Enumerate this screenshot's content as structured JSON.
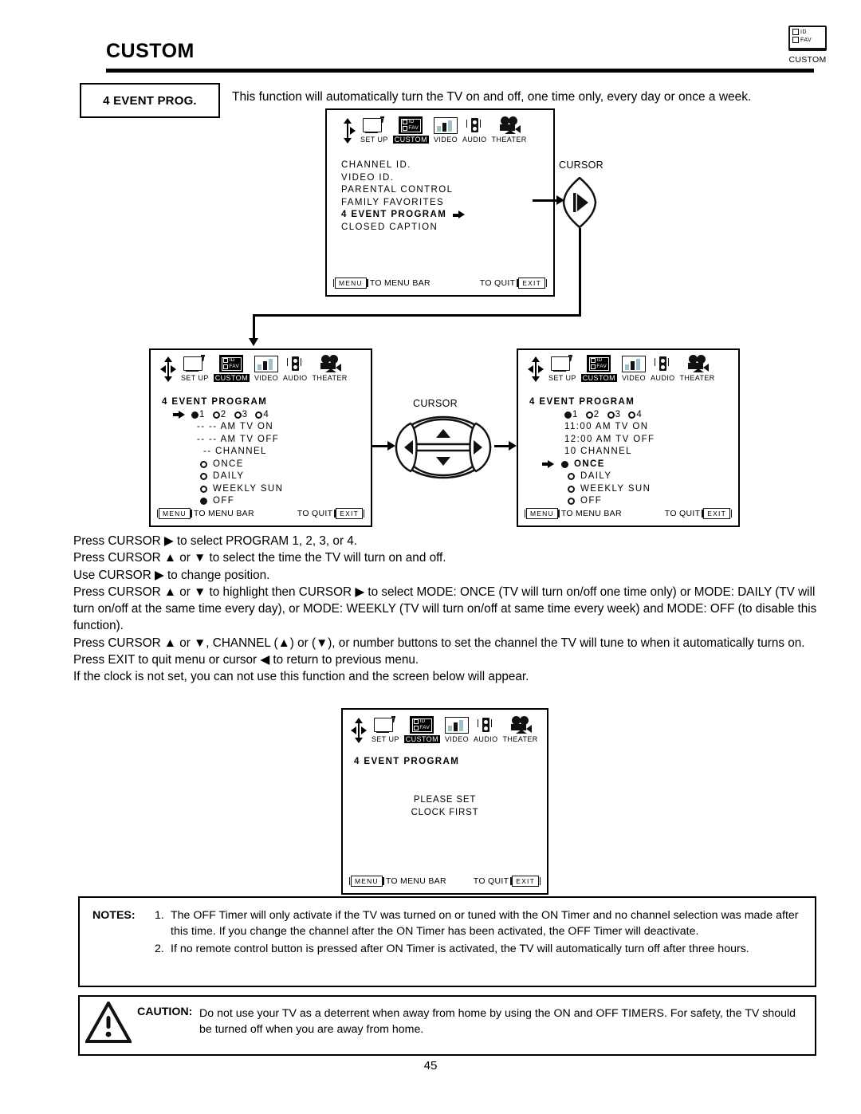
{
  "header": {
    "title": "CUSTOM",
    "corner_logo": {
      "icon": "custom-tv-icon",
      "line1": "ID",
      "line2": "FAV",
      "caption": "CUSTOM"
    }
  },
  "topic": {
    "box_label": "4 EVENT PROG.",
    "intro": "This function will automatically turn the TV on and off, one time only, every day or once a week."
  },
  "menu_icons": [
    {
      "name": "setup-icon",
      "label": "SET UP",
      "selected": false
    },
    {
      "name": "custom-icon",
      "label": "CUSTOM",
      "selected": true
    },
    {
      "name": "video-icon",
      "label": "VIDEO",
      "selected": false
    },
    {
      "name": "audio-icon",
      "label": "AUDIO",
      "selected": false
    },
    {
      "name": "theater-icon",
      "label": "THEATER",
      "selected": false
    }
  ],
  "osd_footer": {
    "menu_key": "MENU",
    "menu_text": "TO MENU BAR",
    "quit_text": "TO QUIT",
    "exit_key": "EXIT"
  },
  "screen_custom_menu": {
    "items": [
      {
        "label": "CHANNEL ID.",
        "highlighted": false,
        "arrow": false
      },
      {
        "label": "VIDEO ID.",
        "highlighted": false,
        "arrow": false
      },
      {
        "label": "PARENTAL CONTROL",
        "highlighted": false,
        "arrow": false
      },
      {
        "label": "FAMILY FAVORITES",
        "highlighted": false,
        "arrow": false
      },
      {
        "label": "4 EVENT PROGRAM",
        "highlighted": true,
        "arrow": true
      },
      {
        "label": "CLOSED CAPTION",
        "highlighted": false,
        "arrow": false
      }
    ]
  },
  "screen_event_blank": {
    "title": "4 EVENT PROGRAM",
    "programs": [
      {
        "label": "1",
        "selected": true
      },
      {
        "label": "2",
        "selected": false
      },
      {
        "label": "3",
        "selected": false
      },
      {
        "label": "4",
        "selected": false
      }
    ],
    "program_row_cursor": true,
    "on_time": "-- --  AM TV ON",
    "off_time": "-- --  AM TV OFF",
    "channel": "--  CHANNEL",
    "modes": [
      {
        "label": "ONCE",
        "selected": false,
        "cursor": false
      },
      {
        "label": "DAILY",
        "selected": false,
        "cursor": false
      },
      {
        "label": "WEEKLY  SUN",
        "selected": false,
        "cursor": false
      },
      {
        "label": "OFF",
        "selected": true,
        "cursor": false
      }
    ]
  },
  "screen_event_filled": {
    "title": "4 EVENT PROGRAM",
    "programs": [
      {
        "label": "1",
        "selected": true
      },
      {
        "label": "2",
        "selected": false
      },
      {
        "label": "3",
        "selected": false
      },
      {
        "label": "4",
        "selected": false
      }
    ],
    "program_row_cursor": false,
    "on_time": "11:00 AM TV ON",
    "off_time": "12:00 AM TV OFF",
    "channel": "10 CHANNEL",
    "modes": [
      {
        "label": "ONCE",
        "selected": true,
        "cursor": true
      },
      {
        "label": "DAILY",
        "selected": false,
        "cursor": false
      },
      {
        "label": "WEEKLY  SUN",
        "selected": false,
        "cursor": false
      },
      {
        "label": "OFF",
        "selected": false,
        "cursor": false
      }
    ]
  },
  "screen_clock_warning": {
    "title": "4 EVENT PROGRAM",
    "message_line1": "PLEASE SET",
    "message_line2": "CLOCK FIRST"
  },
  "callouts": {
    "cursor_top": "CURSOR",
    "cursor_mid": "CURSOR"
  },
  "body_copy": [
    "Press CURSOR ▶ to select PROGRAM 1, 2, 3, or 4.",
    "Press CURSOR ▲ or ▼ to select the time the TV will turn on and off.",
    "Use CURSOR ▶ to change position.",
    "Press CURSOR ▲ or ▼ to highlight then CURSOR ▶ to select MODE: ONCE (TV will turn on/off one time only) or MODE: DAILY (TV will turn on/off at the same time every day), or MODE: WEEKLY (TV will turn on/off at same time every week) and MODE: OFF (to disable this function).",
    "Press CURSOR ▲ or ▼, CHANNEL (▲) or (▼), or number buttons to set the channel the TV will tune to when it automatically turns on.",
    "Press EXIT to quit menu or cursor ◀ to return to previous menu.",
    "If the clock is not set, you can not use this function and the screen below will appear."
  ],
  "notes": {
    "label": "NOTES:",
    "items": [
      {
        "num": "1.",
        "text": "The OFF Timer will only activate if the TV was turned on or tuned with the ON Timer and no channel selection was made after this time.  If you change the channel after the ON Timer has been activated, the OFF Timer will deactivate."
      },
      {
        "num": "2.",
        "text": "If no remote control button is pressed after ON Timer is activated, the TV will automatically turn off after three hours."
      }
    ]
  },
  "caution": {
    "icon": "warning-triangle-icon",
    "label": "CAUTION:",
    "text": "Do not use your TV as a deterrent when away from home by using the ON and OFF TIMERS.  For safety, the TV should be turned off when you are away from home."
  },
  "page_number": "45"
}
